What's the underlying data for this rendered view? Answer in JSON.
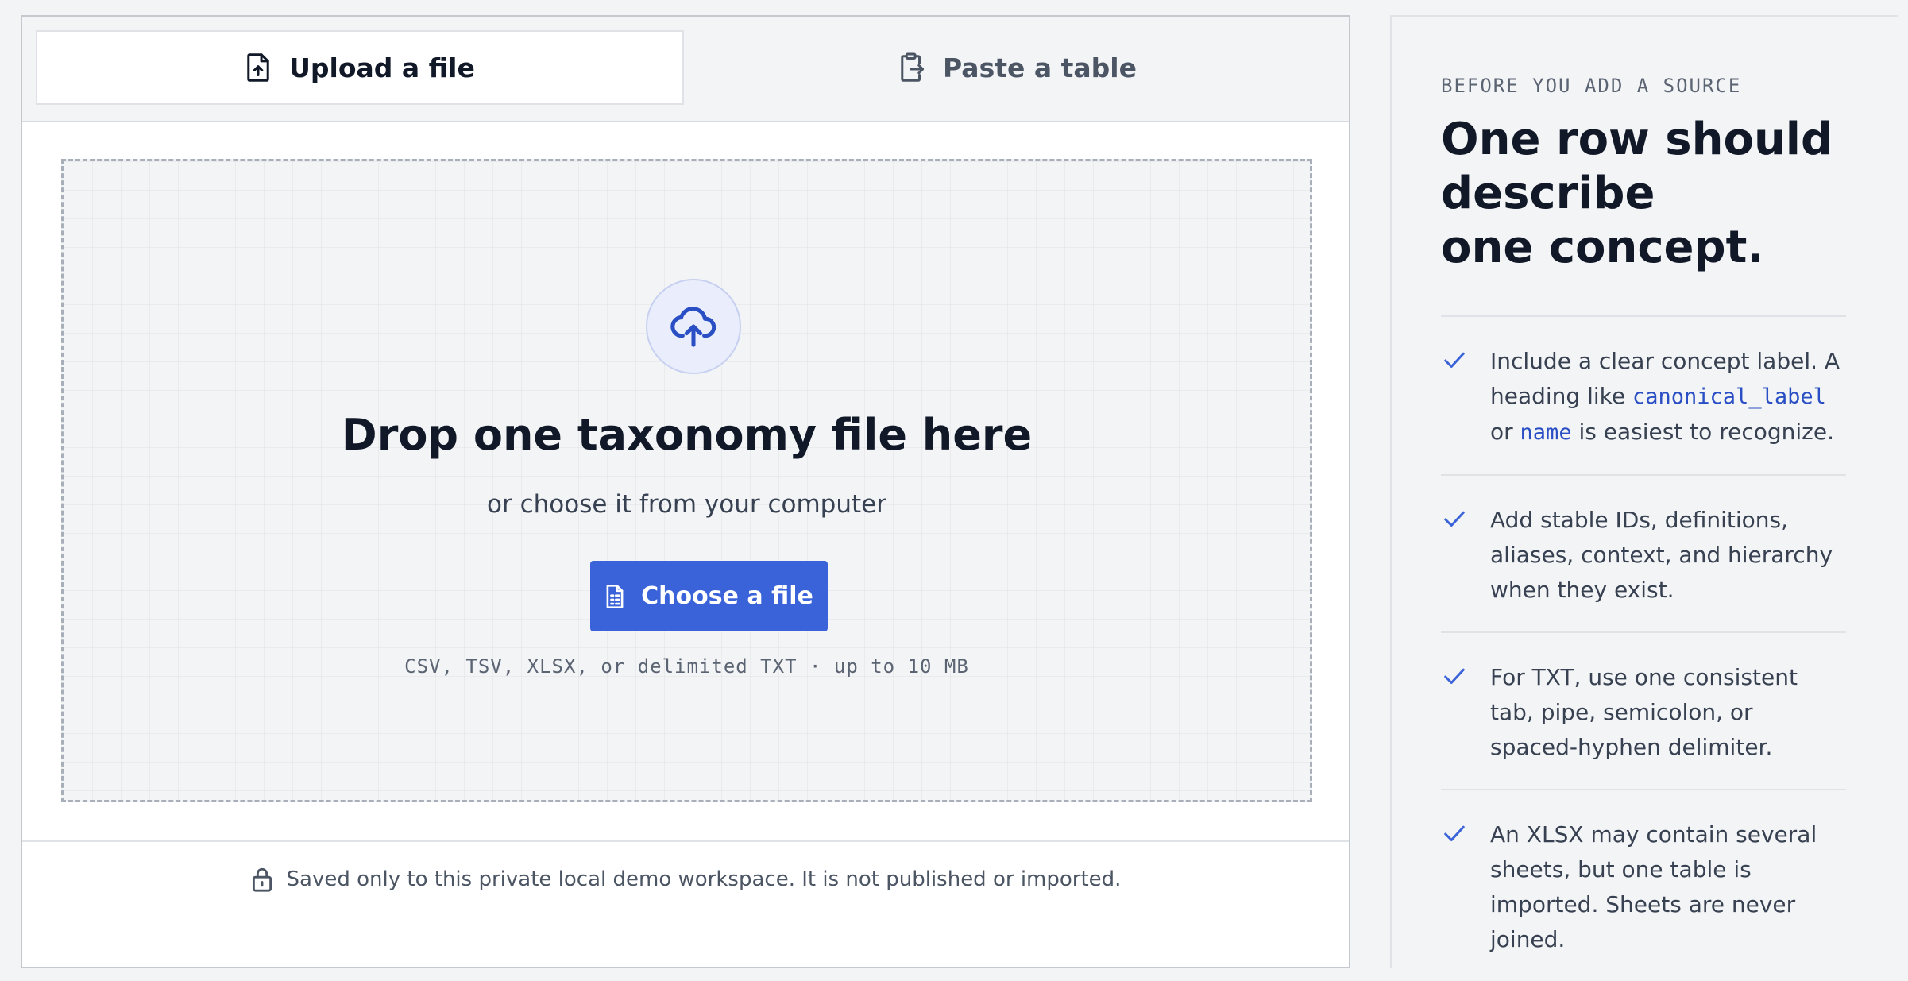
{
  "tabs": [
    {
      "label": "Upload a file",
      "icon": "file-upload-icon",
      "active": true
    },
    {
      "label": "Paste a table",
      "icon": "clipboard-paste-icon",
      "active": false
    }
  ],
  "dropzone": {
    "icon": "cloud-upload-icon",
    "title": "Drop one taxonomy file here",
    "subtitle": "or choose it from your computer",
    "button_label": "Choose a file",
    "button_icon": "document-icon",
    "formats": "CSV, TSV, XLSX, or delimited TXT · up to 10 MB"
  },
  "footer": {
    "icon": "lock-icon",
    "text": "Saved only to this private local demo workspace. It is not published or imported."
  },
  "guide": {
    "eyebrow": "BEFORE YOU ADD A SOURCE",
    "heading_lines": [
      "One row should",
      "describe",
      "one concept."
    ],
    "rules": [
      {
        "before": "Include a clear concept label. A heading like ",
        "code1": "canonical_label",
        "middle": " or ",
        "code2": "name",
        "after": " is easiest to recognize."
      },
      {
        "text": "Add stable IDs, definitions, aliases, context, and hierarchy when they exist."
      },
      {
        "text": "For TXT, use one consistent tab, pipe, semicolon, or spaced-hyphen delimiter."
      },
      {
        "text": "An XLSX may contain several sheets, but one table is imported. Sheets are never joined."
      }
    ]
  },
  "colors": {
    "accent": "#3b63d9",
    "code": "#2a4fc4",
    "background": "#f3f4f6"
  }
}
